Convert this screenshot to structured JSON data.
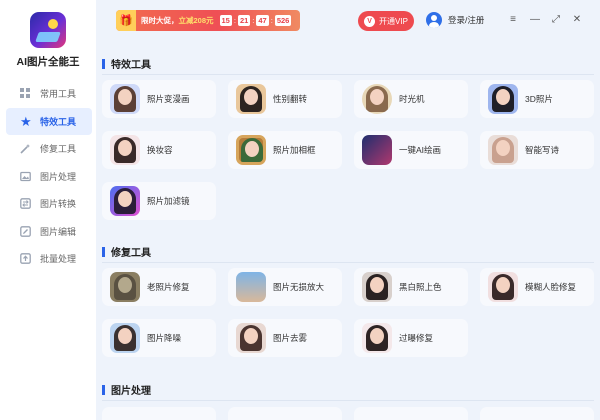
{
  "app": {
    "title": "AI图片全能王"
  },
  "sidebar": {
    "items": [
      {
        "label": "常用工具",
        "icon": "grid-icon",
        "active": false
      },
      {
        "label": "特效工具",
        "icon": "star-icon",
        "active": true
      },
      {
        "label": "修复工具",
        "icon": "wand-icon",
        "active": false
      },
      {
        "label": "图片处理",
        "icon": "image-icon",
        "active": false
      },
      {
        "label": "图片转换",
        "icon": "convert-icon",
        "active": false
      },
      {
        "label": "图片编辑",
        "icon": "edit-icon",
        "active": false
      },
      {
        "label": "批量处理",
        "icon": "upload-icon",
        "active": false
      }
    ]
  },
  "topbar": {
    "promo": {
      "prefix": "限时大促，",
      "highlight": "立减208元",
      "timer": [
        "15",
        "21",
        "47",
        "526"
      ]
    },
    "vip_label": "开通VIP",
    "login_label": "登录/注册",
    "controls": {
      "menu": "≡",
      "minimize": "—",
      "maximize": "⤢",
      "close": "✕"
    }
  },
  "sections": {
    "effects": {
      "title": "特效工具",
      "items": [
        "照片变漫画",
        "性别翻转",
        "时光机",
        "3D照片",
        "换妆容",
        "照片加相框",
        "一键AI绘画",
        "智能写诗",
        "照片加滤镜"
      ]
    },
    "repair": {
      "title": "修复工具",
      "items": [
        "老照片修复",
        "图片无损放大",
        "黑白照上色",
        "模糊人脸修复",
        "图片降噪",
        "图片去雾",
        "过曝修复"
      ]
    },
    "processing": {
      "title": "图片处理"
    }
  },
  "colors": {
    "accent": "#2a63e8",
    "vip": "#ee4a4f",
    "background": "#eef3fb"
  }
}
